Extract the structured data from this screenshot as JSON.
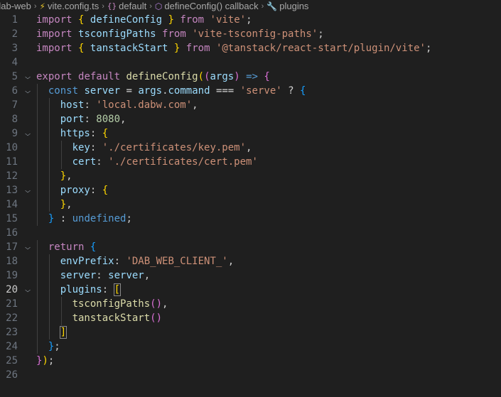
{
  "breadcrumb": [
    {
      "label": "dab-web",
      "icon": null
    },
    {
      "label": "vite.config.ts",
      "icon": "typescript-file-icon"
    },
    {
      "label": "default",
      "icon": "namespace-icon"
    },
    {
      "label": "defineConfig() callback",
      "icon": "function-icon"
    },
    {
      "label": "plugins",
      "icon": "wrench-property-icon"
    }
  ],
  "active_line": 20,
  "lines": [
    {
      "n": "1",
      "fold": false,
      "tokens": [
        [
          "kw",
          "import"
        ],
        [
          "plain",
          " "
        ],
        [
          "br1",
          "{"
        ],
        [
          "plain",
          " "
        ],
        [
          "var",
          "defineConfig"
        ],
        [
          "plain",
          " "
        ],
        [
          "br1",
          "}"
        ],
        [
          "plain",
          " "
        ],
        [
          "kw",
          "from"
        ],
        [
          "plain",
          " "
        ],
        [
          "str",
          "'vite'"
        ],
        [
          "plain",
          ";"
        ]
      ]
    },
    {
      "n": "2",
      "fold": false,
      "tokens": [
        [
          "kw",
          "import"
        ],
        [
          "plain",
          " "
        ],
        [
          "var",
          "tsconfigPaths"
        ],
        [
          "plain",
          " "
        ],
        [
          "kw",
          "from"
        ],
        [
          "plain",
          " "
        ],
        [
          "str",
          "'vite-tsconfig-paths'"
        ],
        [
          "plain",
          ";"
        ]
      ]
    },
    {
      "n": "3",
      "fold": false,
      "tokens": [
        [
          "kw",
          "import"
        ],
        [
          "plain",
          " "
        ],
        [
          "br1",
          "{"
        ],
        [
          "plain",
          " "
        ],
        [
          "var",
          "tanstackStart"
        ],
        [
          "plain",
          " "
        ],
        [
          "br1",
          "}"
        ],
        [
          "plain",
          " "
        ],
        [
          "kw",
          "from"
        ],
        [
          "plain",
          " "
        ],
        [
          "str",
          "'@tanstack/react-start/plugin/vite'"
        ],
        [
          "plain",
          ";"
        ]
      ]
    },
    {
      "n": "4",
      "fold": false,
      "tokens": []
    },
    {
      "n": "5",
      "fold": true,
      "tokens": [
        [
          "kw",
          "export"
        ],
        [
          "plain",
          " "
        ],
        [
          "kw",
          "default"
        ],
        [
          "plain",
          " "
        ],
        [
          "fn",
          "defineConfig"
        ],
        [
          "br1",
          "("
        ],
        [
          "br2",
          "("
        ],
        [
          "var",
          "args"
        ],
        [
          "br2",
          ")"
        ],
        [
          "plain",
          " "
        ],
        [
          "kw2",
          "=>"
        ],
        [
          "plain",
          " "
        ],
        [
          "br2",
          "{"
        ]
      ]
    },
    {
      "n": "6",
      "fold": true,
      "tokens": [
        [
          "plain",
          "  "
        ],
        [
          "kw2",
          "const"
        ],
        [
          "plain",
          " "
        ],
        [
          "var",
          "server"
        ],
        [
          "plain",
          " "
        ],
        [
          "op",
          "="
        ],
        [
          "plain",
          " "
        ],
        [
          "var",
          "args"
        ],
        [
          "plain",
          "."
        ],
        [
          "var",
          "command"
        ],
        [
          "plain",
          " "
        ],
        [
          "op",
          "==="
        ],
        [
          "plain",
          " "
        ],
        [
          "str",
          "'serve'"
        ],
        [
          "plain",
          " "
        ],
        [
          "op",
          "?"
        ],
        [
          "plain",
          " "
        ],
        [
          "br3",
          "{"
        ]
      ]
    },
    {
      "n": "7",
      "fold": false,
      "tokens": [
        [
          "plain",
          "    "
        ],
        [
          "var",
          "host"
        ],
        [
          "plain",
          ": "
        ],
        [
          "str",
          "'local.dabw.com'"
        ],
        [
          "plain",
          ","
        ]
      ]
    },
    {
      "n": "8",
      "fold": false,
      "tokens": [
        [
          "plain",
          "    "
        ],
        [
          "var",
          "port"
        ],
        [
          "plain",
          ": "
        ],
        [
          "num",
          "8080"
        ],
        [
          "plain",
          ","
        ]
      ]
    },
    {
      "n": "9",
      "fold": true,
      "tokens": [
        [
          "plain",
          "    "
        ],
        [
          "var",
          "https"
        ],
        [
          "plain",
          ": "
        ],
        [
          "br1",
          "{"
        ]
      ]
    },
    {
      "n": "10",
      "fold": false,
      "tokens": [
        [
          "plain",
          "      "
        ],
        [
          "var",
          "key"
        ],
        [
          "plain",
          ": "
        ],
        [
          "str",
          "'./certificates/key.pem'"
        ],
        [
          "plain",
          ","
        ]
      ]
    },
    {
      "n": "11",
      "fold": false,
      "tokens": [
        [
          "plain",
          "      "
        ],
        [
          "var",
          "cert"
        ],
        [
          "plain",
          ": "
        ],
        [
          "str",
          "'./certificates/cert.pem'"
        ]
      ]
    },
    {
      "n": "12",
      "fold": false,
      "tokens": [
        [
          "plain",
          "    "
        ],
        [
          "br1",
          "}"
        ],
        [
          "plain",
          ","
        ]
      ]
    },
    {
      "n": "13",
      "fold": true,
      "tokens": [
        [
          "plain",
          "    "
        ],
        [
          "var",
          "proxy"
        ],
        [
          "plain",
          ": "
        ],
        [
          "br1",
          "{"
        ]
      ]
    },
    {
      "n": "14",
      "fold": false,
      "tokens": [
        [
          "plain",
          "    "
        ],
        [
          "br1",
          "}"
        ],
        [
          "plain",
          ","
        ]
      ]
    },
    {
      "n": "15",
      "fold": false,
      "tokens": [
        [
          "plain",
          "  "
        ],
        [
          "br3",
          "}"
        ],
        [
          "plain",
          " "
        ],
        [
          "op",
          ":"
        ],
        [
          "plain",
          " "
        ],
        [
          "kw2",
          "undefined"
        ],
        [
          "plain",
          ";"
        ]
      ]
    },
    {
      "n": "16",
      "fold": false,
      "tokens": []
    },
    {
      "n": "17",
      "fold": true,
      "tokens": [
        [
          "plain",
          "  "
        ],
        [
          "kw",
          "return"
        ],
        [
          "plain",
          " "
        ],
        [
          "br3",
          "{"
        ]
      ]
    },
    {
      "n": "18",
      "fold": false,
      "tokens": [
        [
          "plain",
          "    "
        ],
        [
          "var",
          "envPrefix"
        ],
        [
          "plain",
          ": "
        ],
        [
          "str",
          "'DAB_WEB_CLIENT_'"
        ],
        [
          "plain",
          ","
        ]
      ]
    },
    {
      "n": "19",
      "fold": false,
      "tokens": [
        [
          "plain",
          "    "
        ],
        [
          "var",
          "server"
        ],
        [
          "plain",
          ": "
        ],
        [
          "var",
          "server"
        ],
        [
          "plain",
          ","
        ]
      ]
    },
    {
      "n": "20",
      "fold": true,
      "tokens": [
        [
          "plain",
          "    "
        ],
        [
          "var",
          "plugins"
        ],
        [
          "plain",
          ": "
        ],
        [
          "br1m",
          "["
        ]
      ]
    },
    {
      "n": "21",
      "fold": false,
      "tokens": [
        [
          "plain",
          "      "
        ],
        [
          "fn",
          "tsconfigPaths"
        ],
        [
          "br2",
          "()"
        ],
        [
          "plain",
          ","
        ]
      ]
    },
    {
      "n": "22",
      "fold": false,
      "tokens": [
        [
          "plain",
          "      "
        ],
        [
          "fn",
          "tanstackStart"
        ],
        [
          "br2",
          "()"
        ]
      ]
    },
    {
      "n": "23",
      "fold": false,
      "tokens": [
        [
          "plain",
          "    "
        ],
        [
          "br1m",
          "]"
        ]
      ]
    },
    {
      "n": "24",
      "fold": false,
      "tokens": [
        [
          "plain",
          "  "
        ],
        [
          "br3",
          "}"
        ],
        [
          "plain",
          ";"
        ]
      ]
    },
    {
      "n": "25",
      "fold": false,
      "tokens": [
        [
          "br2",
          "}"
        ],
        [
          "br1",
          ")"
        ],
        [
          "plain",
          ";"
        ]
      ]
    },
    {
      "n": "26",
      "fold": false,
      "tokens": []
    }
  ],
  "colors": {
    "background": "#1f1f1f",
    "keyword": "#c586c0",
    "storage": "#569cd6",
    "variable": "#9cdcfe",
    "function": "#dcdcaa",
    "string": "#ce9178",
    "number": "#b5cea8"
  }
}
